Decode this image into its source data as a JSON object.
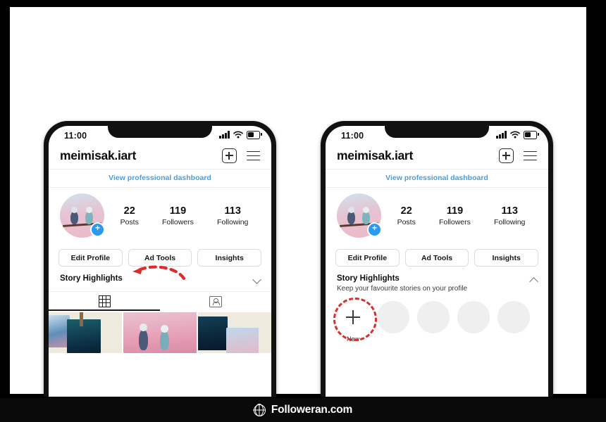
{
  "footer": {
    "site": "Followeran.com",
    "icon": "globe-icon"
  },
  "phones": [
    {
      "id": "left",
      "state": "collapsed",
      "status": {
        "time": "11:00",
        "signal": "signal-bars-icon",
        "wifi": "wifi-icon",
        "battery": "battery-icon"
      },
      "header": {
        "username": "meimisak.iart",
        "add_icon": "plus-square-icon",
        "menu_icon": "hamburger-menu-icon"
      },
      "dashboard_link": "View professional dashboard",
      "stats": [
        {
          "num": "22",
          "label": "Posts"
        },
        {
          "num": "119",
          "label": "Followers"
        },
        {
          "num": "113",
          "label": "Following"
        }
      ],
      "actions": [
        "Edit Profile",
        "Ad Tools",
        "Insights"
      ],
      "story": {
        "title": "Story Highlights",
        "subtitle": "",
        "chevron": "chevron-down-icon"
      },
      "annotation": {
        "type": "red-dashed-arrow",
        "color": "#e02b2b",
        "points_to": "Story Highlights"
      },
      "tabs": [
        {
          "icon": "grid-icon",
          "active": true
        },
        {
          "icon": "tagged-photos-icon",
          "active": false
        }
      ]
    },
    {
      "id": "right",
      "state": "expanded",
      "status": {
        "time": "11:00",
        "signal": "signal-bars-icon",
        "wifi": "wifi-icon",
        "battery": "battery-icon"
      },
      "header": {
        "username": "meimisak.iart",
        "add_icon": "plus-square-icon",
        "menu_icon": "hamburger-menu-icon"
      },
      "dashboard_link": "View professional dashboard",
      "stats": [
        {
          "num": "22",
          "label": "Posts"
        },
        {
          "num": "119",
          "label": "Followers"
        },
        {
          "num": "113",
          "label": "Following"
        }
      ],
      "actions": [
        "Edit Profile",
        "Ad Tools",
        "Insights"
      ],
      "story": {
        "title": "Story Highlights",
        "subtitle": "Keep your favourite stories on your profile",
        "chevron": "chevron-up-icon"
      },
      "highlights": [
        {
          "label": "New",
          "kind": "new",
          "ringed": true
        },
        {
          "label": "",
          "kind": "placeholder",
          "ringed": false
        },
        {
          "label": "",
          "kind": "placeholder",
          "ringed": false
        },
        {
          "label": "",
          "kind": "placeholder",
          "ringed": false
        },
        {
          "label": "",
          "kind": "placeholder",
          "ringed": false
        }
      ],
      "annotation": {
        "type": "red-dashed-circle",
        "color": "#e02b2b",
        "points_to": "New highlight button"
      }
    }
  ],
  "colors": {
    "link": "#4a9ee0",
    "accent_red": "#e02b2b",
    "badge_blue": "#2a9bf0",
    "frame": "#111111"
  }
}
